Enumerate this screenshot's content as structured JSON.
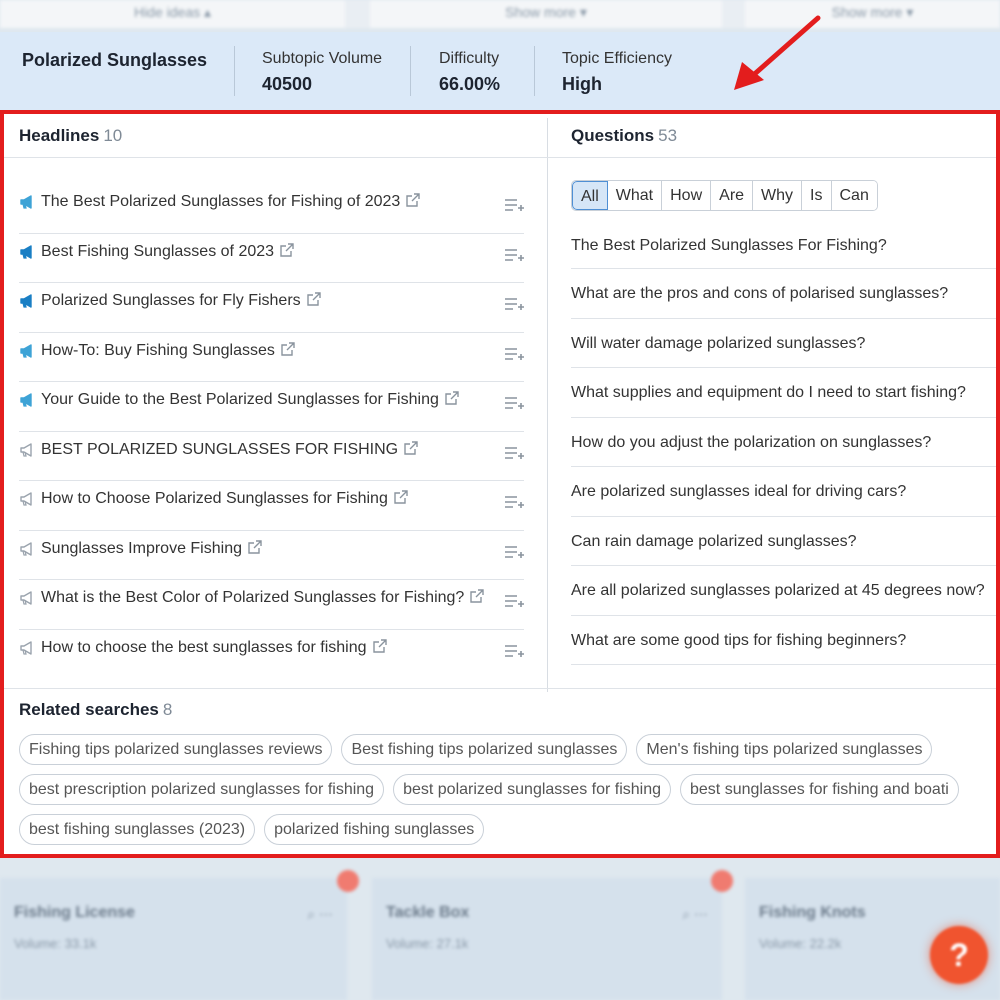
{
  "top_strip": {
    "col1": "Hide ideas ▴",
    "col2": "Show more ▾",
    "col3": "Show more ▾"
  },
  "summary": {
    "topic": "Polarized Sunglasses",
    "subtopic_volume_label": "Subtopic Volume",
    "subtopic_volume": "40500",
    "difficulty_label": "Difficulty",
    "difficulty": "66.00%",
    "efficiency_label": "Topic Efficiency",
    "efficiency": "High"
  },
  "colors": {
    "highlight_border": "#e31d1d",
    "megaphone_active": "#1a7fc4",
    "megaphone_muted": "#9aa3ad",
    "chip_active": "#d6e6f7",
    "arrow": "#e31d1d"
  },
  "headlines": {
    "title": "Headlines",
    "count": "10",
    "items": [
      {
        "text": "The Best Polarized Sunglasses for Fishing of 2023",
        "icon": "megaphone-light-icon"
      },
      {
        "text": "Best Fishing Sunglasses of 2023",
        "icon": "megaphone-dark-icon"
      },
      {
        "text": "Polarized Sunglasses for Fly Fishers",
        "icon": "megaphone-dark-icon"
      },
      {
        "text": "How-To: Buy Fishing Sunglasses",
        "icon": "megaphone-light-icon"
      },
      {
        "text": "Your Guide to the Best Polarized Sunglasses for Fishing",
        "icon": "megaphone-light-icon"
      },
      {
        "text": "BEST POLARIZED SUNGLASSES FOR FISHING",
        "icon": "megaphone-outline-icon"
      },
      {
        "text": "How to Choose Polarized Sunglasses for Fishing",
        "icon": "megaphone-outline-icon"
      },
      {
        "text": "Sunglasses Improve Fishing",
        "icon": "megaphone-outline-icon"
      },
      {
        "text": "What is the Best Color of Polarized Sunglasses for Fishing?",
        "icon": "megaphone-outline-icon"
      },
      {
        "text": "How to choose the best sunglasses for fishing",
        "icon": "megaphone-outline-icon"
      }
    ]
  },
  "questions": {
    "title": "Questions",
    "count": "53",
    "filters": [
      "All",
      "What",
      "How",
      "Are",
      "Why",
      "Is",
      "Can"
    ],
    "active_filter": "All",
    "items": [
      "The Best Polarized Sunglasses For Fishing?",
      "What are the pros and cons of polarised sunglasses?",
      "Will water damage polarized sunglasses?",
      "What supplies and equipment do I need to start fishing?",
      "How do you adjust the polarization on sunglasses?",
      "Are polarized sunglasses ideal for driving cars?",
      "Can rain damage polarized sunglasses?",
      "Are all polarized sunglasses polarized at 45 degrees now?",
      "What are some good tips for fishing beginners?"
    ]
  },
  "related": {
    "title": "Related searches",
    "count": "8",
    "rows": [
      [
        "Fishing tips polarized sunglasses reviews",
        "Best fishing tips polarized sunglasses",
        "Men's fishing tips polarized sunglasses"
      ],
      [
        "best prescription polarized sunglasses for fishing",
        "best polarized sunglasses for fishing",
        "best sunglasses for fishing and boati"
      ],
      [
        "best fishing sunglasses (2023)",
        "polarized fishing sunglasses"
      ]
    ]
  },
  "bottom_cards": [
    {
      "title": "Fishing License",
      "volume": "Volume: 33.1k"
    },
    {
      "title": "Tackle Box",
      "volume": "Volume: 27.1k"
    },
    {
      "title": "Fishing Knots",
      "volume": "Volume: 22.2k"
    }
  ],
  "help_label": "?"
}
